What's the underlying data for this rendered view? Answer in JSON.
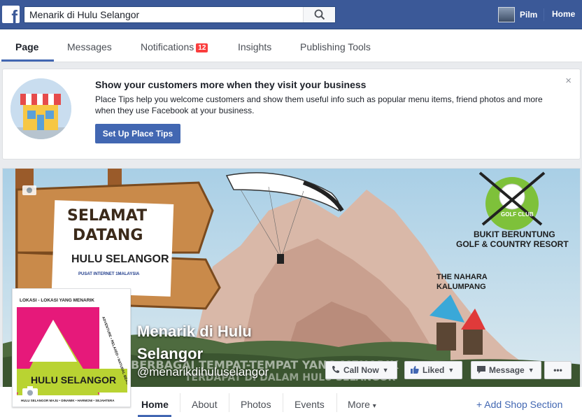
{
  "topbar": {
    "search_value": "Menarik di Hulu Selangor",
    "user_name": "Pilm",
    "home_label": "Home"
  },
  "tabs": [
    {
      "label": "Page",
      "active": true
    },
    {
      "label": "Messages"
    },
    {
      "label": "Notifications",
      "badge": "12"
    },
    {
      "label": "Insights"
    },
    {
      "label": "Publishing Tools"
    }
  ],
  "place_tips": {
    "title": "Show your customers more when they visit your business",
    "body": "Place Tips help you welcome customers and show them useful info such as popular menu items, friend photos and more when they use Facebook at your business.",
    "button": "Set Up Place Tips",
    "close": "×"
  },
  "cover": {
    "sign_line1": "SELAMAT",
    "sign_line2": "DATANG",
    "sign_line3": "HULU SELANGOR",
    "sign_small": "PUSAT INTERNET 1MALAYSIA",
    "golf_club": "GOLF CLUB",
    "resort_line1": "BUKIT BERUNTUNG",
    "resort_line2": "GOLF & COUNTRY RESORT",
    "nahara_line1": "THE NAHARA",
    "nahara_line2": "KALUMPANG",
    "banner_text_1": "BERBAGAI TEMPAT-TEMPAT YANG MENARIK",
    "banner_text_2": "TERDAPAT DI DALAM HULU SELANGOR"
  },
  "page": {
    "name": "Menarik di Hulu Selangor",
    "handle": "@menarikdihuluselangor"
  },
  "profile": {
    "top_text": "LOKASI - LOKASI YANG MENARIK",
    "side_text": "ADVENTURE • RELAXED • NATURAL BEAUTY",
    "brand": "HULU SELANGOR",
    "footer": "HULU SELANGOR MAJU • DINAMIK • HARMONI • SEJAHTERA"
  },
  "actions": {
    "call_now": "Call Now",
    "liked": "Liked",
    "message": "Message",
    "more": "•••"
  },
  "page_nav": {
    "items": [
      "Home",
      "About",
      "Photos",
      "Events",
      "More"
    ],
    "more_caret": "▾",
    "add_shop": "+ Add Shop Section"
  },
  "colors": {
    "brand_blue": "#3b5998",
    "button_blue": "#4267b2",
    "badge_red": "#fa3e3e"
  }
}
